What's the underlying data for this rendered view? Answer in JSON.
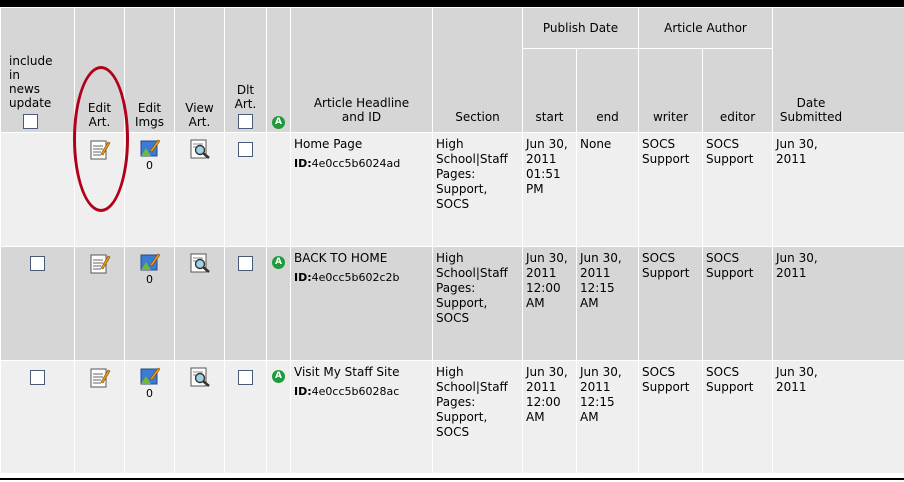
{
  "headers": {
    "include": "include in news update",
    "edit_art": "Edit Art.",
    "edit_imgs": "Edit Imgs",
    "view_art": "View Art.",
    "dlt_art": "Dlt Art.",
    "headline": "Article Headline and ID",
    "section": "Section",
    "publish_date": "Publish Date",
    "article_author": "Article Author",
    "start": "start",
    "end": "end",
    "writer": "writer",
    "editor": "editor",
    "date_submitted": "Date Submitted"
  },
  "icons": {
    "approved": "A",
    "approved_color": "#1f9a3c",
    "highlight_color": "#b0001a"
  },
  "rows": [
    {
      "images": "0",
      "approved": false,
      "headline": "Home Page",
      "id_label": "ID:",
      "id": "4e0cc5b6024ad",
      "section": "High School|Staff Pages: Support, SOCS",
      "start": "Jun 30, 2011 01:51 PM",
      "end": "None",
      "writer": "SOCS Support",
      "editor": "SOCS Support",
      "submitted": "Jun 30, 2011"
    },
    {
      "images": "0",
      "approved": true,
      "headline": "BACK TO HOME",
      "id_label": "ID:",
      "id": "4e0cc5b602c2b",
      "section": "High School|Staff Pages: Support, SOCS",
      "start": "Jun 30, 2011 12:00 AM",
      "end": "Jun 30, 2011 12:15 AM",
      "writer": "SOCS Support",
      "editor": "SOCS Support",
      "submitted": "Jun 30, 2011"
    },
    {
      "images": "0",
      "approved": true,
      "headline": "Visit My Staff Site",
      "id_label": "ID:",
      "id": "4e0cc5b6028ac",
      "section": "High School|Staff Pages: Support, SOCS",
      "start": "Jun 30, 2011 12:00 AM",
      "end": "Jun 30, 2011 12:15 AM",
      "writer": "SOCS Support",
      "editor": "SOCS Support",
      "submitted": "Jun 30, 2011"
    }
  ]
}
